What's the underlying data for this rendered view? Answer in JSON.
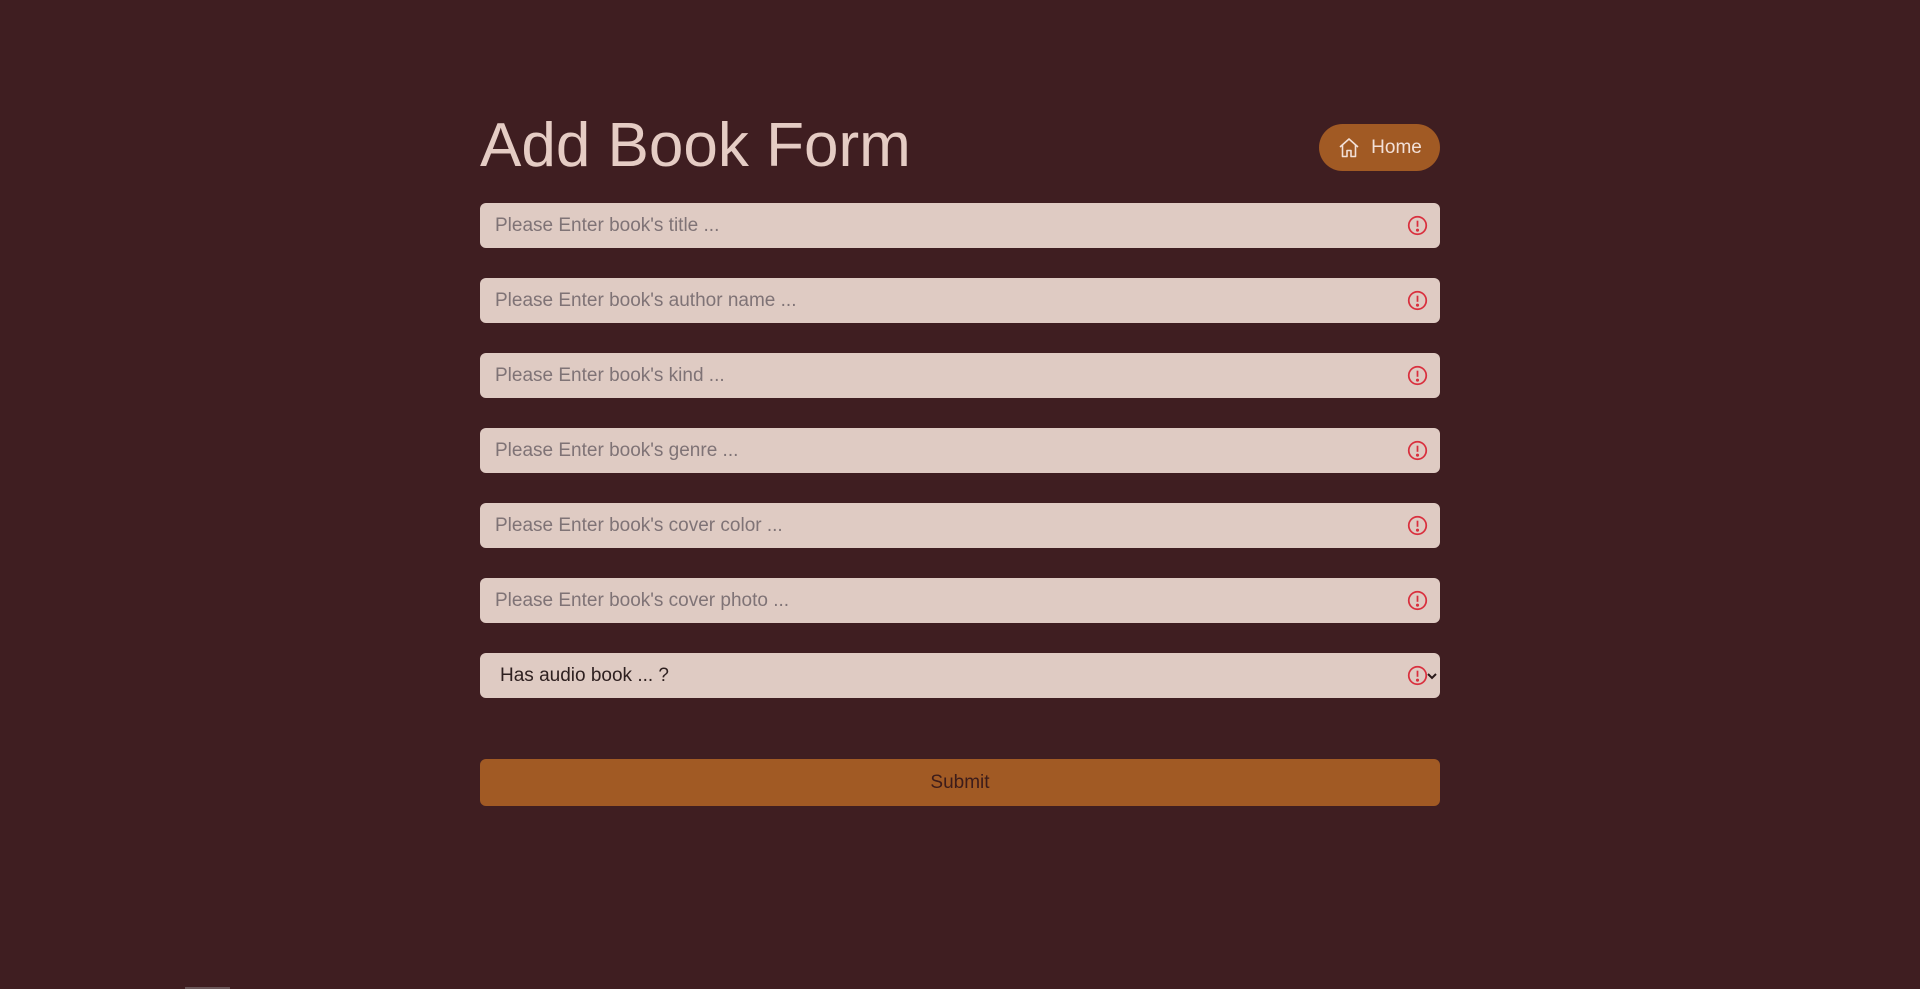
{
  "header": {
    "title": "Add Book Form",
    "home_label": "Home",
    "home_icon": "home-icon"
  },
  "form": {
    "fields": [
      {
        "placeholder": "Please Enter book's title ...",
        "value": ""
      },
      {
        "placeholder": "Please Enter book's author name ...",
        "value": ""
      },
      {
        "placeholder": "Please Enter book's kind ...",
        "value": ""
      },
      {
        "placeholder": "Please Enter book's genre ...",
        "value": ""
      },
      {
        "placeholder": "Please Enter book's cover color ...",
        "value": ""
      },
      {
        "placeholder": "Please Enter book's cover photo ...",
        "value": ""
      }
    ],
    "audio_select": {
      "selected": "Has audio book ... ?"
    },
    "submit_label": "Submit"
  },
  "colors": {
    "background": "#3f1e21",
    "accent": "#a15a24",
    "field_background": "#dfcbc3",
    "invalid": "#d9303e"
  }
}
